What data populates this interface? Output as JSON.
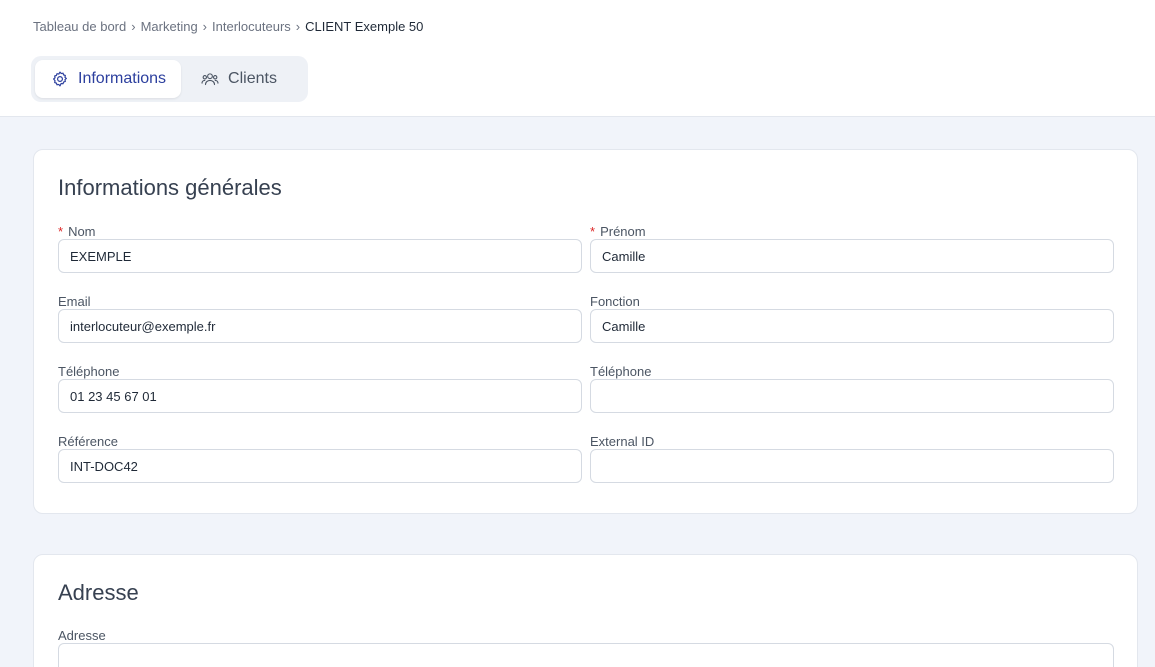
{
  "breadcrumb": [
    {
      "label": "Tableau de bord"
    },
    {
      "label": "Marketing"
    },
    {
      "label": "Interlocuteurs"
    },
    {
      "label": "CLIENT Exemple 50"
    }
  ],
  "tabs": [
    {
      "label": "Informations",
      "icon": "gear-icon",
      "active": true
    },
    {
      "label": "Clients",
      "icon": "users-icon",
      "active": false
    }
  ],
  "general": {
    "title": "Informations générales",
    "nom": {
      "label": "Nom",
      "required": true,
      "value": "EXEMPLE"
    },
    "prenom": {
      "label": "Prénom",
      "required": true,
      "value": "Camille"
    },
    "email": {
      "label": "Email",
      "value": "interlocuteur@exemple.fr"
    },
    "fonction": {
      "label": "Fonction",
      "value": "Camille"
    },
    "telephone1": {
      "label": "Téléphone",
      "value": "01 23 45 67 01"
    },
    "telephone2": {
      "label": "Téléphone",
      "value": ""
    },
    "reference": {
      "label": "Référence",
      "value": "INT-DOC42"
    },
    "external_id": {
      "label": "External ID",
      "value": ""
    }
  },
  "address": {
    "title": "Adresse",
    "adresse": {
      "label": "Adresse",
      "value": ""
    }
  },
  "colors": {
    "accent": "#2c3f9e",
    "required": "#dc2626",
    "page_bg": "#f1f4fa"
  }
}
